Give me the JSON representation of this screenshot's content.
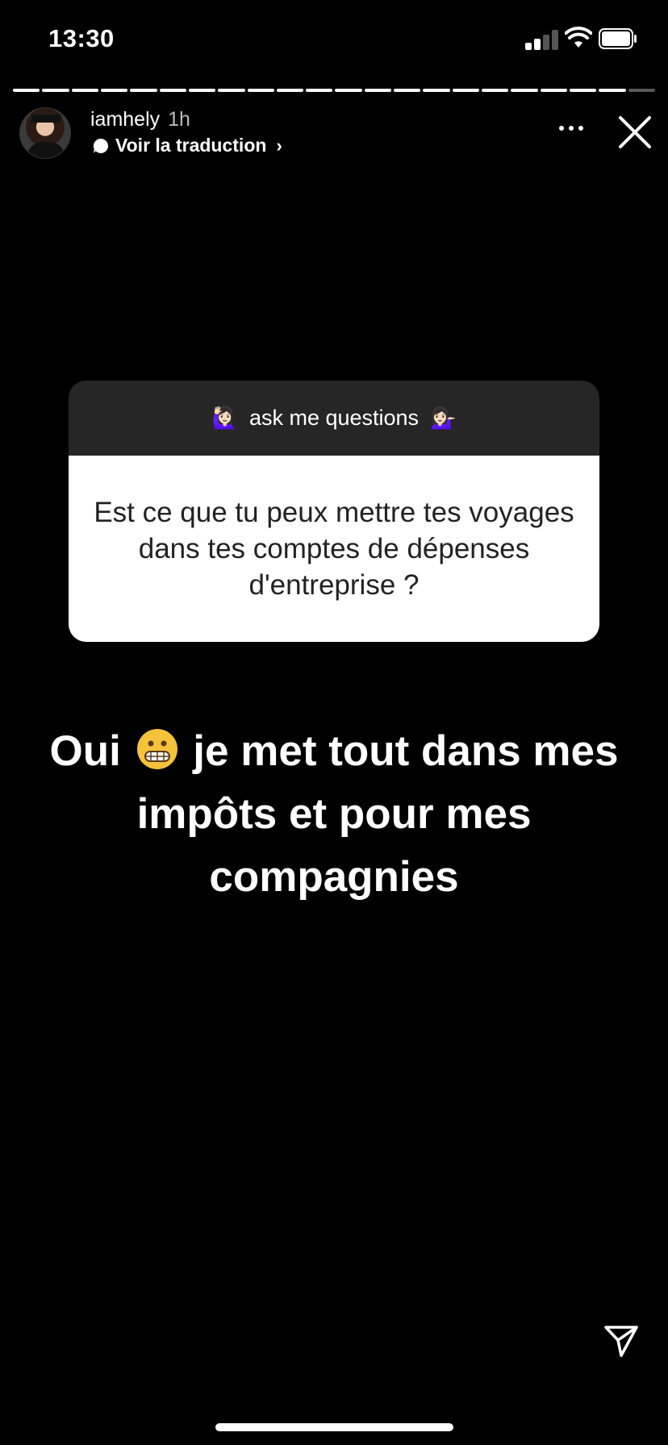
{
  "status_bar": {
    "time": "13:30",
    "signal_icon": "cellular-signal-icon",
    "wifi_icon": "wifi-icon",
    "battery_icon": "battery-icon"
  },
  "story": {
    "segments_total": 22,
    "segments_viewed": 21
  },
  "header": {
    "username": "iamhely",
    "time_ago": "1h",
    "translate_label": "Voir la traduction",
    "more_icon": "more-options-icon",
    "close_icon": "close-icon"
  },
  "question_sticker": {
    "title": "ask me questions",
    "emoji_left": "🙋🏻‍♀️",
    "emoji_right": "💁🏻‍♀️",
    "question": "Est ce que tu peux mettre tes voyages dans tes comptes de dépenses d'entreprise ?"
  },
  "answer": {
    "part1": "Oui",
    "emoji": "grimacing-face-emoji",
    "part2": "je met tout dans mes impôts et pour mes compagnies"
  },
  "footer": {
    "send_icon": "send-icon"
  },
  "colors": {
    "background": "#000000",
    "sticker_header": "#262626",
    "sticker_body": "#ffffff"
  }
}
